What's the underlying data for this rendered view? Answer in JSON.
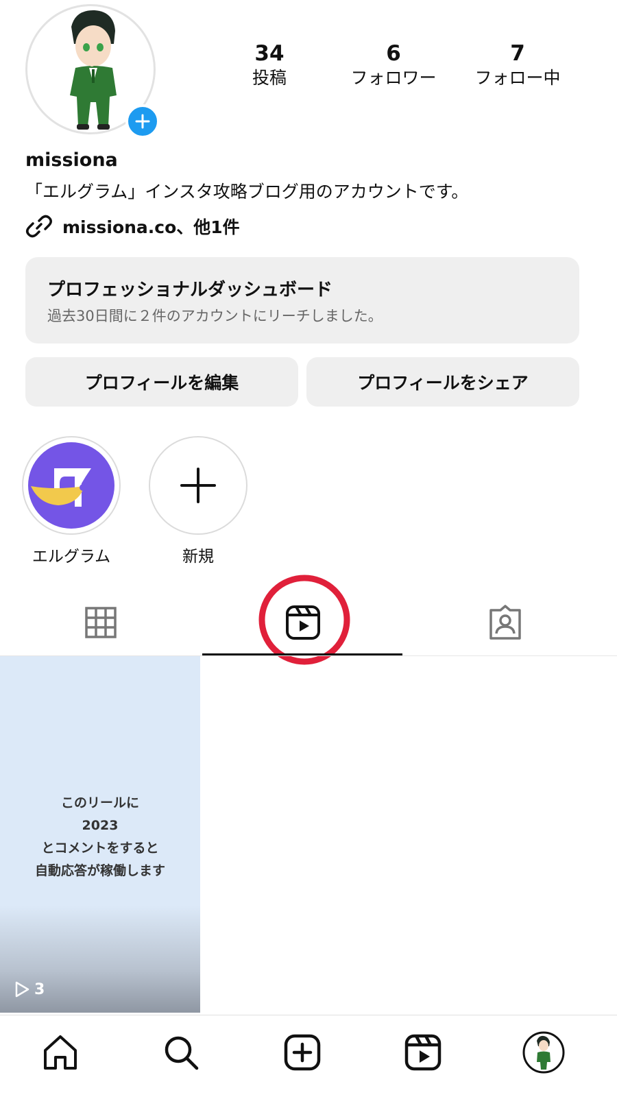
{
  "profile": {
    "username": "missiona",
    "bio": "「エルグラム」インスタ攻略ブログ用のアカウントです。",
    "link_text": "missiona.co、他1件"
  },
  "stats": [
    {
      "value": "34",
      "label": "投稿"
    },
    {
      "value": "6",
      "label": "フォロワー"
    },
    {
      "value": "7",
      "label": "フォロー中"
    }
  ],
  "dashboard": {
    "title": "プロフェッショナルダッシュボード",
    "subtitle": "過去30日間に２件のアカウントにリーチしました。"
  },
  "buttons": {
    "edit_profile": "プロフィールを編集",
    "share_profile": "プロフィールをシェア"
  },
  "highlights": [
    {
      "label": "エルグラム"
    },
    {
      "label": "新規"
    }
  ],
  "tabs": [
    "grid-icon",
    "reels-icon",
    "tagged-icon"
  ],
  "active_tab": "reels-icon",
  "reel": {
    "lines": [
      "このリールに",
      "2023",
      "とコメントをすると",
      "自動応答が稼働します"
    ],
    "play_count": "3"
  },
  "bottom_nav": [
    "home-icon",
    "search-icon",
    "create-icon",
    "reels-icon",
    "profile-avatar"
  ],
  "colors": {
    "accent_blue": "#1d9bf0",
    "highlight_circle_red": "#e0203a",
    "logo_purple": "#7455e6",
    "logo_yellow": "#f2c94c",
    "reel_tile_bg": "#dce9f8"
  }
}
